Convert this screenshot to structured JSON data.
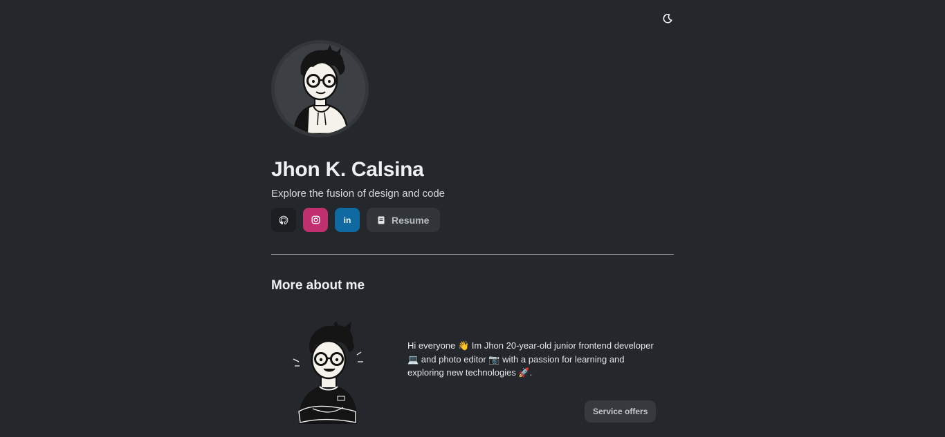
{
  "header": {
    "theme_toggle_icon": "moon-icon"
  },
  "profile": {
    "name": "Jhon K. Calsina",
    "tagline": "Explore the fusion of design and code",
    "avatar_icon": "avatar-illustration"
  },
  "socials": {
    "github_icon": "github-icon",
    "instagram_icon": "instagram-icon",
    "linkedin_label": "in",
    "resume_icon": "document-icon",
    "resume_label": "Resume"
  },
  "about": {
    "title": "More about me",
    "bio": "Hi everyone 👋 Im Jhon 20-year-old junior frontend developer 💻 and photo editor 📷 with a passion for learning and exploring new technologies 🚀.",
    "service_label": "Service offers"
  },
  "colors": {
    "background": "#24272b",
    "github": "#1c1e21",
    "instagram": "#c0306f",
    "linkedin": "#0e6aa1",
    "button": "#323539"
  }
}
